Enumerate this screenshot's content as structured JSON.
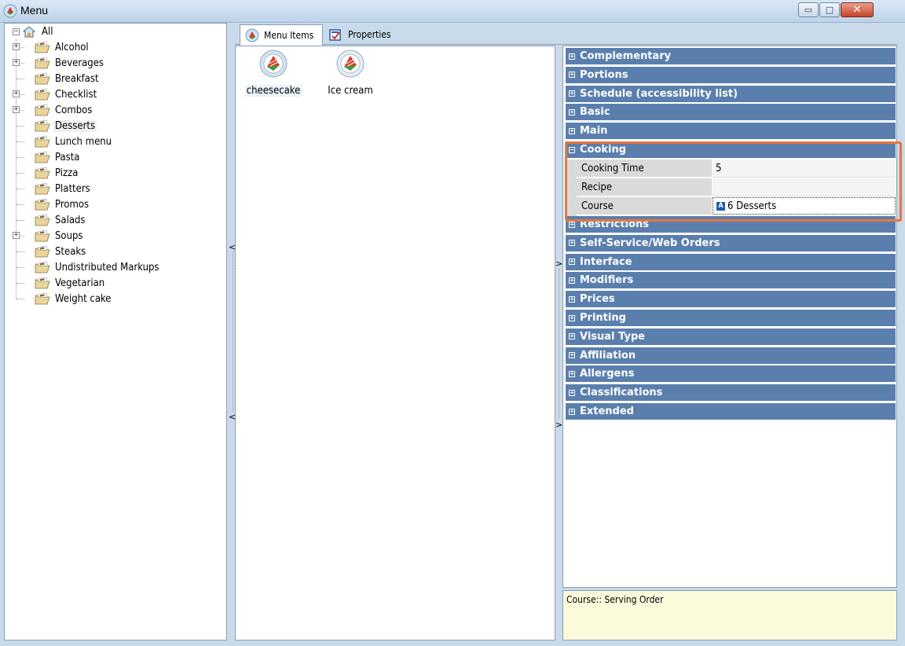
{
  "window": {
    "title": "Menu",
    "buttons": {
      "minimize": "▭",
      "maximize": "□",
      "close": "✕"
    }
  },
  "tree": {
    "root": "All",
    "items": [
      {
        "label": "Alcohol",
        "expandable": true
      },
      {
        "label": "Beverages",
        "expandable": true
      },
      {
        "label": "Breakfast",
        "expandable": false
      },
      {
        "label": "Checklist",
        "expandable": true
      },
      {
        "label": "Combos",
        "expandable": true
      },
      {
        "label": "Desserts",
        "expandable": false,
        "selected": true
      },
      {
        "label": "Lunch menu",
        "expandable": false
      },
      {
        "label": "Pasta",
        "expandable": false
      },
      {
        "label": "Pizza",
        "expandable": false
      },
      {
        "label": "Platters",
        "expandable": false
      },
      {
        "label": "Promos",
        "expandable": false
      },
      {
        "label": "Salads",
        "expandable": false
      },
      {
        "label": "Soups",
        "expandable": true
      },
      {
        "label": "Steaks",
        "expandable": false
      },
      {
        "label": "Undistributed Markups",
        "expandable": false
      },
      {
        "label": "Vegetarian",
        "expandable": false
      },
      {
        "label": "Weight cake",
        "expandable": false
      }
    ]
  },
  "tabs": [
    {
      "label": "Menu Items",
      "active": true,
      "icon": "menu-items-icon"
    },
    {
      "label": "Properties",
      "active": false,
      "icon": "properties-icon"
    }
  ],
  "menu_items": [
    {
      "label": "cheesecake",
      "selected": true
    },
    {
      "label": "Ice cream",
      "selected": false
    }
  ],
  "property_grid": {
    "categories_before": [
      "Complementary",
      "Portions",
      "Schedule (accessibility list)",
      "Basic",
      "Main"
    ],
    "expanded_category": {
      "label": "Cooking",
      "properties": [
        {
          "name": "Cooking Time",
          "value": "5"
        },
        {
          "name": "Recipe",
          "value": ""
        },
        {
          "name": "Course",
          "value": "6 Desserts",
          "badge": "A"
        }
      ]
    },
    "categories_after": [
      "Restrictions",
      "Self-Service/Web Orders",
      "Interface",
      "Modifiers",
      "Prices",
      "Printing",
      "Visual Type",
      "Affiliation",
      "Allergens",
      "Classifications",
      "Extended"
    ],
    "highlight_color": "#e8773c",
    "category_color": "#5a7fad"
  },
  "description": "Course:: Serving Order"
}
